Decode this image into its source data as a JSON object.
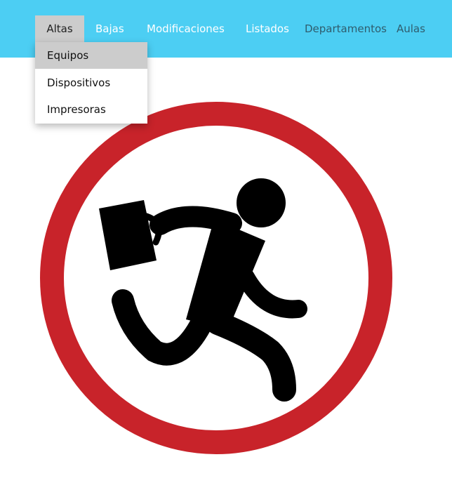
{
  "nav": {
    "items": [
      "Altas",
      "Bajas",
      "Modificaciones",
      "Listados",
      "Departamentos",
      "Aulas"
    ],
    "active": "Altas"
  },
  "dropdown": {
    "items": [
      "Equipos",
      "Dispositivos",
      "Impresoras"
    ],
    "active": "Equipos"
  },
  "colors": {
    "navbar": "#4ccef3",
    "active_bg": "#cccccc",
    "sign_red": "#c8232a",
    "figure": "#000000"
  },
  "image": {
    "icon": "no-running-sign-icon"
  }
}
